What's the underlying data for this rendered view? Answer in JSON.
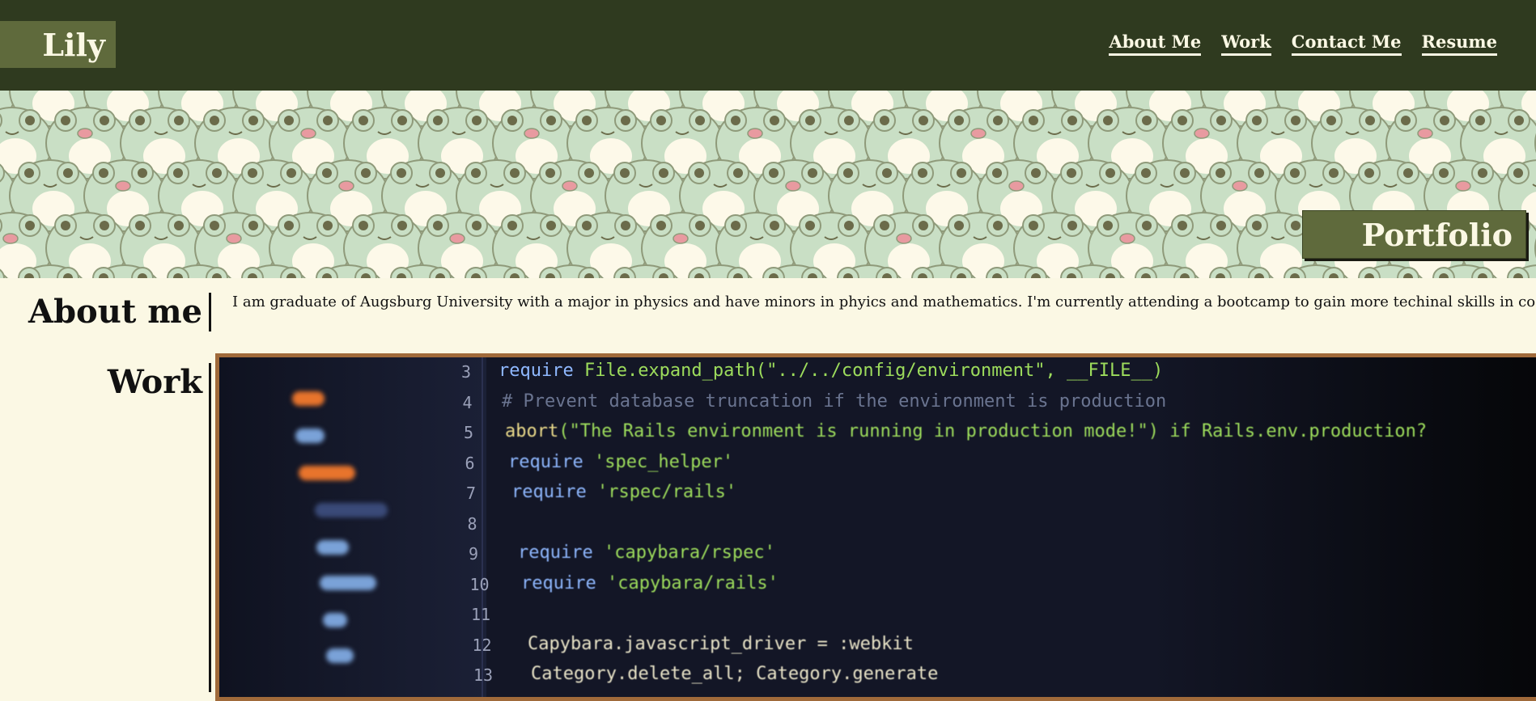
{
  "header": {
    "brand": "Lily",
    "nav": [
      "About Me",
      "Work",
      "Contact Me",
      "Resume"
    ]
  },
  "hero": {
    "badge": "Portfolio"
  },
  "about": {
    "title": "About me",
    "text": "I am graduate of Augsburg University with a major in physics and have minors in phyics and mathematics. I'm currently attending a bootcamp to gain more techinal skills in coding."
  },
  "work": {
    "title": "Work",
    "code": {
      "lines": [
        {
          "num": "3",
          "text": "require File.expand_path(\"../../config/environment\", __FILE__)"
        },
        {
          "num": "4",
          "text": "# Prevent database truncation if the environment is production"
        },
        {
          "num": "5",
          "text": "abort(\"The Rails environment is running in production mode!\") if Rails.env.production?"
        },
        {
          "num": "6",
          "text": "require 'spec_helper'"
        },
        {
          "num": "7",
          "text": "require 'rspec/rails'"
        },
        {
          "num": "8",
          "text": ""
        },
        {
          "num": "9",
          "text": "require 'capybara/rspec'"
        },
        {
          "num": "10",
          "text": "require 'capybara/rails'"
        },
        {
          "num": "11",
          "text": ""
        },
        {
          "num": "12",
          "text": "Capybara.javascript_driver = :webkit"
        },
        {
          "num": "13",
          "text": "Category.delete_all; Category.generate"
        }
      ]
    }
  },
  "colors": {
    "header_bg": "#2f3a1f",
    "accent": "#5f6a3c",
    "page_bg": "#fbf8e4",
    "frame_border": "#a06a3a",
    "frog_green": "#c9dfc5"
  }
}
